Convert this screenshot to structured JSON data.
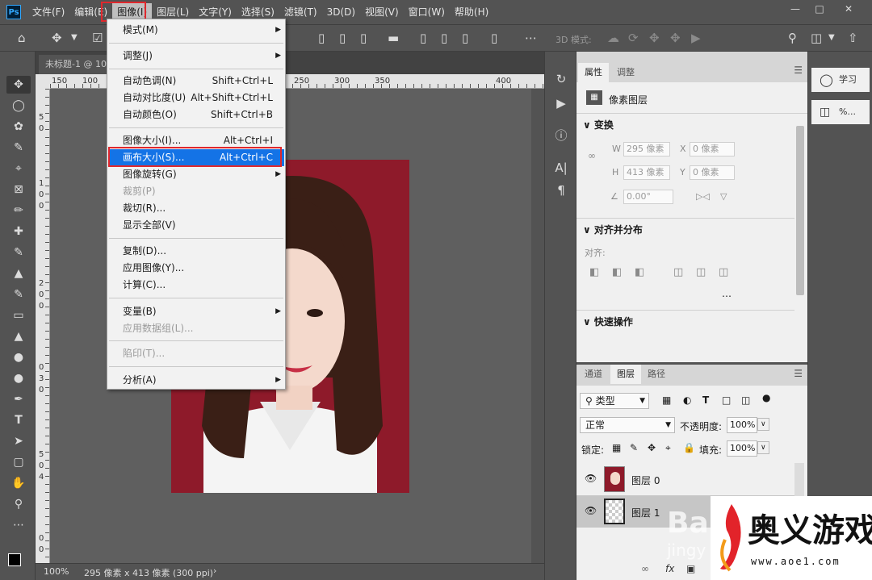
{
  "menubar": {
    "logo": "Ps",
    "items": [
      "文件(F)",
      "编辑(E)",
      "图像(I)",
      "图层(L)",
      "文字(Y)",
      "选择(S)",
      "滤镜(T)",
      "3D(D)",
      "视图(V)",
      "窗口(W)",
      "帮助(H)"
    ],
    "active_index": 2
  },
  "optionsbar": {
    "mode_label": "3D 模式:"
  },
  "document": {
    "tab_title": "未标题-1 @ 10",
    "ruler_top_labels": [
      "150",
      "100",
      "150",
      "200",
      "250",
      "300",
      "350",
      "400"
    ],
    "ruler_left_labels": [
      "5",
      "0",
      "5",
      "0",
      "1",
      "0",
      "0",
      "1",
      "5",
      "0",
      "2",
      "0",
      "0",
      "2",
      "5",
      "0",
      "3",
      "0",
      "0",
      "3",
      "5",
      "0",
      "4",
      "0",
      "0"
    ],
    "zoom": "100%",
    "status": "295 像素 x 413 像素 (300 ppi)"
  },
  "image_menu": {
    "items": [
      {
        "label": "模式(M)",
        "shortcut": "",
        "submenu": true,
        "disabled": false
      },
      {
        "sep": true
      },
      {
        "label": "调整(J)",
        "shortcut": "",
        "submenu": true,
        "disabled": false
      },
      {
        "sep": true
      },
      {
        "label": "自动色调(N)",
        "shortcut": "Shift+Ctrl+L",
        "submenu": false,
        "disabled": false
      },
      {
        "label": "自动对比度(U)",
        "shortcut": "Alt+Shift+Ctrl+L",
        "submenu": false,
        "disabled": false
      },
      {
        "label": "自动颜色(O)",
        "shortcut": "Shift+Ctrl+B",
        "submenu": false,
        "disabled": false
      },
      {
        "sep": true
      },
      {
        "label": "图像大小(I)...",
        "shortcut": "Alt+Ctrl+I",
        "submenu": false,
        "disabled": false
      },
      {
        "label": "画布大小(S)...",
        "shortcut": "Alt+Ctrl+C",
        "submenu": false,
        "disabled": false,
        "highlighted": true
      },
      {
        "label": "图像旋转(G)",
        "shortcut": "",
        "submenu": true,
        "disabled": false
      },
      {
        "label": "裁剪(P)",
        "shortcut": "",
        "submenu": false,
        "disabled": true
      },
      {
        "label": "裁切(R)...",
        "shortcut": "",
        "submenu": false,
        "disabled": false
      },
      {
        "label": "显示全部(V)",
        "shortcut": "",
        "submenu": false,
        "disabled": false
      },
      {
        "sep": true
      },
      {
        "label": "复制(D)...",
        "shortcut": "",
        "submenu": false,
        "disabled": false
      },
      {
        "label": "应用图像(Y)...",
        "shortcut": "",
        "submenu": false,
        "disabled": false
      },
      {
        "label": "计算(C)...",
        "shortcut": "",
        "submenu": false,
        "disabled": false
      },
      {
        "sep": true
      },
      {
        "label": "变量(B)",
        "shortcut": "",
        "submenu": true,
        "disabled": false
      },
      {
        "label": "应用数据组(L)...",
        "shortcut": "",
        "submenu": false,
        "disabled": true
      },
      {
        "sep": true
      },
      {
        "label": "陷印(T)...",
        "shortcut": "",
        "submenu": false,
        "disabled": true
      },
      {
        "sep": true
      },
      {
        "label": "分析(A)",
        "shortcut": "",
        "submenu": true,
        "disabled": false
      }
    ]
  },
  "properties": {
    "tabs": [
      "属性",
      "调整"
    ],
    "layer_kind": "像素图层",
    "transform_title": "变换",
    "w_label": "W",
    "w_value": "295 像素",
    "x_label": "X",
    "x_value": "0 像素",
    "h_label": "H",
    "h_value": "413 像素",
    "y_label": "Y",
    "y_value": "0 像素",
    "angle_value": "0.00°",
    "align_title": "对齐并分布",
    "align_label": "对齐:",
    "quick_title": "快速操作"
  },
  "layers_panel": {
    "tabs": [
      "通道",
      "图层",
      "路径"
    ],
    "filter_kind": "类型",
    "blend_mode": "正常",
    "opacity_label": "不透明度:",
    "opacity_value": "100%",
    "lock_label": "锁定:",
    "fill_label": "填充:",
    "fill_value": "100%",
    "layers": [
      {
        "name": "图层 0"
      },
      {
        "name": "图层 1"
      }
    ]
  },
  "learn_panel": {
    "learn_label": "学习",
    "percent_label": "%..."
  },
  "watermark": {
    "site_name": "奥义游戏网",
    "site_url": "www.aoe1.com",
    "baidu_text": "Bai",
    "jingyan_text": "jingy"
  },
  "colors": {
    "accent": "#1473e6",
    "highlight_box": "#e0282d",
    "photo_bg": "#8e1a2a"
  }
}
